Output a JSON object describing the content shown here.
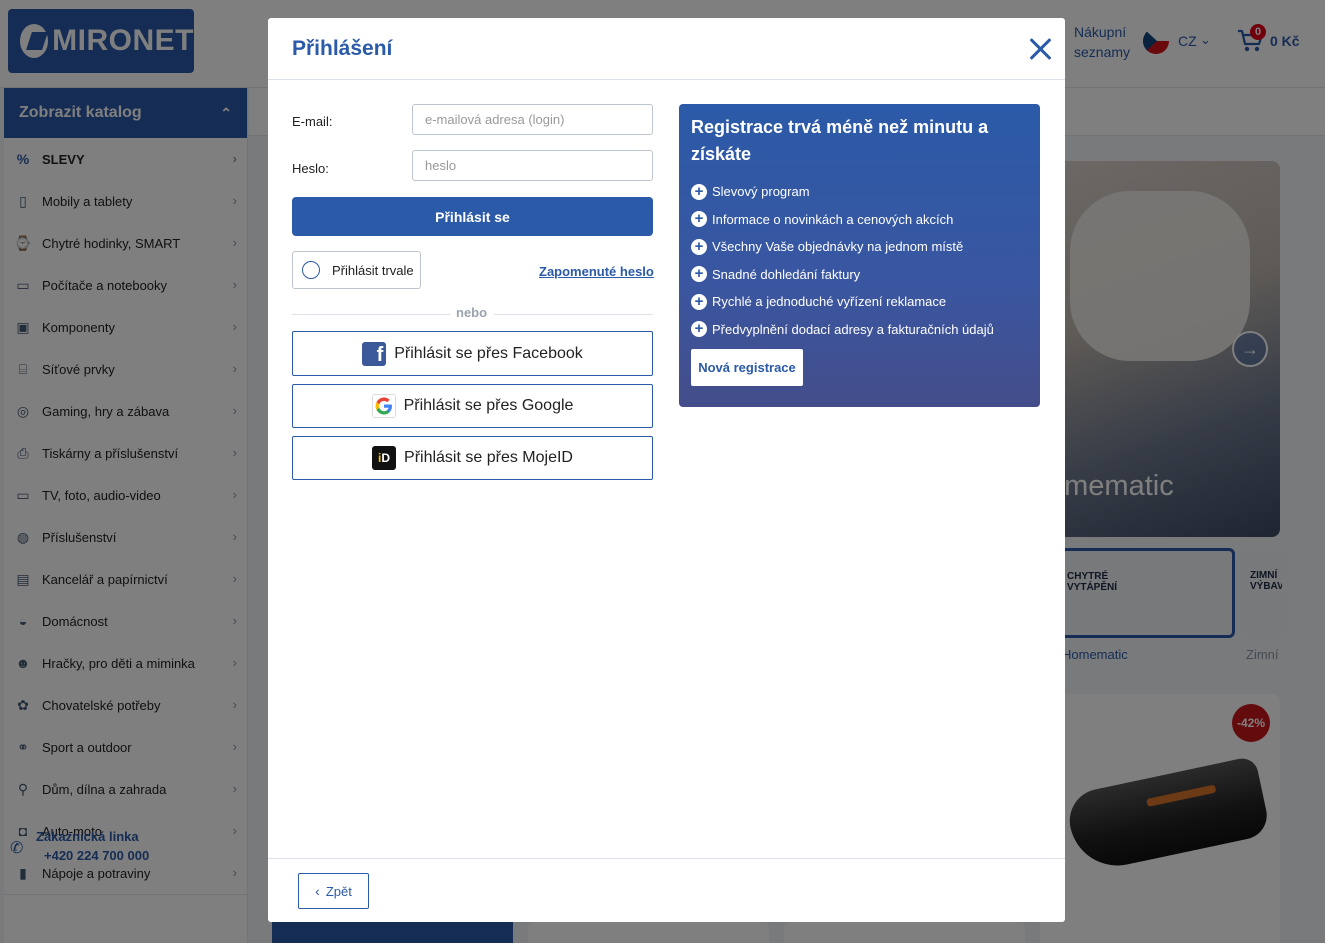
{
  "header": {
    "logo_text": "MIRONET",
    "shopping_lists": "Nákupní seznamy",
    "language": "CZ",
    "cart_count": "0",
    "cart_price": "0 Kč"
  },
  "sidebar": {
    "catalog_label": "Zobrazit katalog",
    "items": [
      {
        "label": "SLEVY",
        "icon": "percent-icon"
      },
      {
        "label": "Mobily a tablety",
        "icon": "phone-icon"
      },
      {
        "label": "Chytré hodinky, SMART",
        "icon": "watch-icon"
      },
      {
        "label": "Počítače a notebooky",
        "icon": "laptop-icon"
      },
      {
        "label": "Komponenty",
        "icon": "chip-icon"
      },
      {
        "label": "Síťové prvky",
        "icon": "router-icon"
      },
      {
        "label": "Gaming, hry a zábava",
        "icon": "gamepad-icon"
      },
      {
        "label": "Tiskárny a příslušenství",
        "icon": "printer-icon"
      },
      {
        "label": "TV, foto, audio-video",
        "icon": "tv-icon"
      },
      {
        "label": "Příslušenství",
        "icon": "mouse-icon"
      },
      {
        "label": "Kancelář a papírnictví",
        "icon": "notebook-icon"
      },
      {
        "label": "Domácnost",
        "icon": "pot-icon"
      },
      {
        "label": "Hračky, pro děti a miminka",
        "icon": "teddy-icon"
      },
      {
        "label": "Chovatelské potřeby",
        "icon": "paw-icon"
      },
      {
        "label": "Sport a outdoor",
        "icon": "bike-icon"
      },
      {
        "label": "Dům, dílna a zahrada",
        "icon": "wheelbarrow-icon"
      },
      {
        "label": "Auto-moto",
        "icon": "car-icon"
      },
      {
        "label": "Nápoje a potraviny",
        "icon": "bottle-icon"
      }
    ],
    "support_label": "Zákaznická linka",
    "support_phone": "+420 224 700 000"
  },
  "background": {
    "hero_brand": "omematic",
    "thumb1_title": "CHYTRÉ VYTÁPĚNÍ",
    "thumb1_caption": "Homematic",
    "thumb2_title": "ZIMNÍ VÝBAV",
    "thumb2_caption": "Zimní",
    "discount": "-42%"
  },
  "modal": {
    "title": "Přihlášení",
    "email_label": "E-mail:",
    "email_placeholder": "e-mailová adresa (login)",
    "email_value": "",
    "password_label": "Heslo:",
    "password_placeholder": "heslo",
    "password_value": "",
    "login_button": "Přihlásit se",
    "remember_label": "Přihlásit trvale",
    "forgot_link": "Zapomenuté heslo",
    "divider_text": "nebo",
    "facebook_button": "Přihlásit se přes Facebook",
    "google_button": "Přihlásit se přes Google",
    "mojeid_button": "Přihlásit se přes MojeID",
    "back_button": "Zpět"
  },
  "promo": {
    "title": "Registrace trvá méně než minutu a získáte",
    "benefits": [
      "Slevový program",
      "Informace o novinkách a cenových akcích",
      "Všechny Vaše objednávky na jednom místě",
      "Snadné dohledání faktury",
      "Rychlé a jednoduché vyřízení reklamace",
      "Předvyplnění dodací adresy a fakturačních údajů"
    ],
    "register_button": "Nová registrace"
  },
  "colors": {
    "brand_blue": "#2b5aa8",
    "overlay": "rgba(0,0,0,0.5)",
    "discount_red": "#c8171d"
  }
}
